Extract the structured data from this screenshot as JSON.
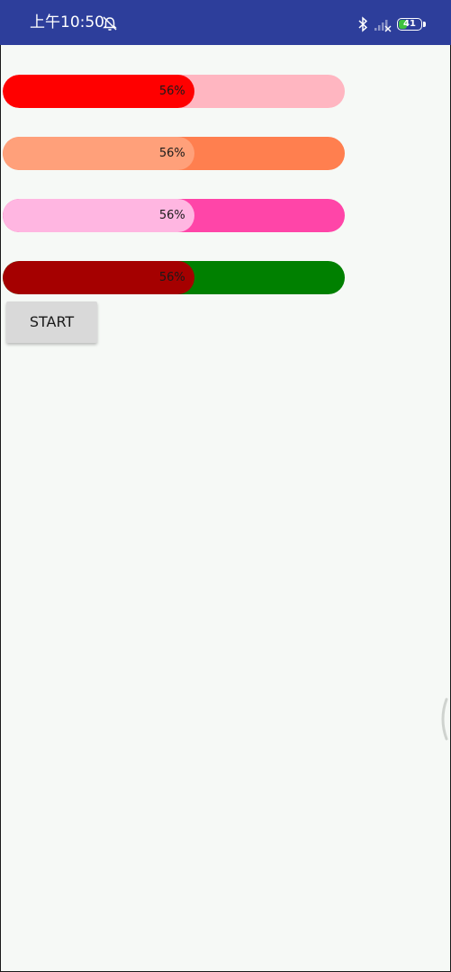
{
  "status_bar": {
    "time": "上午10:50",
    "battery_level": "41",
    "icons": [
      "alarm-off-icon",
      "bluetooth-icon",
      "no-signal-icon",
      "battery-icon"
    ],
    "colors": {
      "background": "#2d3e9b",
      "battery_green": "#3ec13e"
    }
  },
  "progress_bars": [
    {
      "label": "56%",
      "value": 0.56,
      "fill_color": "#ff0000",
      "track_color": "#ffb6c1"
    },
    {
      "label": "56%",
      "value": 0.56,
      "fill_color": "#ffa07a",
      "track_color": "#ff7f4f"
    },
    {
      "label": "56%",
      "value": 0.56,
      "fill_color": "#ffb6e1",
      "track_color": "#ff45a8"
    },
    {
      "label": "56%",
      "value": 0.56,
      "fill_color": "#a50000",
      "track_color": "#008000"
    }
  ],
  "start_button": {
    "label": "START",
    "background": "#d9d9d9"
  },
  "background_color": "#f6f9f6"
}
